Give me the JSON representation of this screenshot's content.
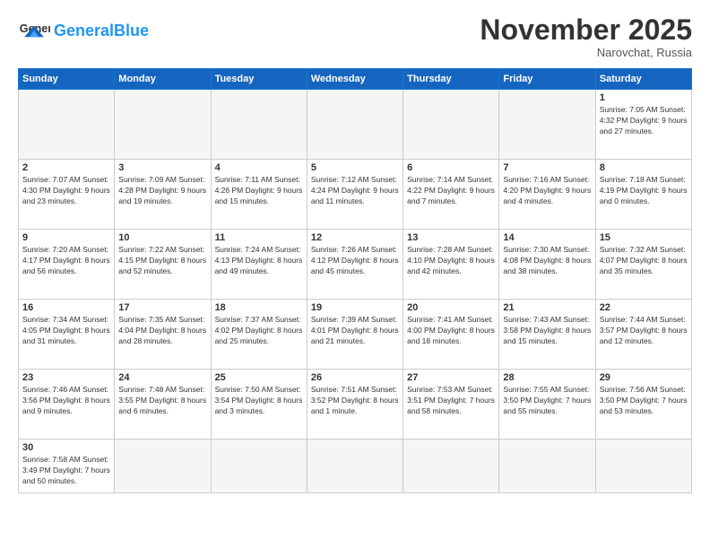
{
  "header": {
    "logo_general": "General",
    "logo_blue": "Blue",
    "month_title": "November 2025",
    "location": "Narovchat, Russia"
  },
  "days_of_week": [
    "Sunday",
    "Monday",
    "Tuesday",
    "Wednesday",
    "Thursday",
    "Friday",
    "Saturday"
  ],
  "weeks": [
    [
      {
        "day": "",
        "info": ""
      },
      {
        "day": "",
        "info": ""
      },
      {
        "day": "",
        "info": ""
      },
      {
        "day": "",
        "info": ""
      },
      {
        "day": "",
        "info": ""
      },
      {
        "day": "",
        "info": ""
      },
      {
        "day": "1",
        "info": "Sunrise: 7:05 AM\nSunset: 4:32 PM\nDaylight: 9 hours\nand 27 minutes."
      }
    ],
    [
      {
        "day": "2",
        "info": "Sunrise: 7:07 AM\nSunset: 4:30 PM\nDaylight: 9 hours\nand 23 minutes."
      },
      {
        "day": "3",
        "info": "Sunrise: 7:09 AM\nSunset: 4:28 PM\nDaylight: 9 hours\nand 19 minutes."
      },
      {
        "day": "4",
        "info": "Sunrise: 7:11 AM\nSunset: 4:26 PM\nDaylight: 9 hours\nand 15 minutes."
      },
      {
        "day": "5",
        "info": "Sunrise: 7:12 AM\nSunset: 4:24 PM\nDaylight: 9 hours\nand 11 minutes."
      },
      {
        "day": "6",
        "info": "Sunrise: 7:14 AM\nSunset: 4:22 PM\nDaylight: 9 hours\nand 7 minutes."
      },
      {
        "day": "7",
        "info": "Sunrise: 7:16 AM\nSunset: 4:20 PM\nDaylight: 9 hours\nand 4 minutes."
      },
      {
        "day": "8",
        "info": "Sunrise: 7:18 AM\nSunset: 4:19 PM\nDaylight: 9 hours\nand 0 minutes."
      }
    ],
    [
      {
        "day": "9",
        "info": "Sunrise: 7:20 AM\nSunset: 4:17 PM\nDaylight: 8 hours\nand 56 minutes."
      },
      {
        "day": "10",
        "info": "Sunrise: 7:22 AM\nSunset: 4:15 PM\nDaylight: 8 hours\nand 52 minutes."
      },
      {
        "day": "11",
        "info": "Sunrise: 7:24 AM\nSunset: 4:13 PM\nDaylight: 8 hours\nand 49 minutes."
      },
      {
        "day": "12",
        "info": "Sunrise: 7:26 AM\nSunset: 4:12 PM\nDaylight: 8 hours\nand 45 minutes."
      },
      {
        "day": "13",
        "info": "Sunrise: 7:28 AM\nSunset: 4:10 PM\nDaylight: 8 hours\nand 42 minutes."
      },
      {
        "day": "14",
        "info": "Sunrise: 7:30 AM\nSunset: 4:08 PM\nDaylight: 8 hours\nand 38 minutes."
      },
      {
        "day": "15",
        "info": "Sunrise: 7:32 AM\nSunset: 4:07 PM\nDaylight: 8 hours\nand 35 minutes."
      }
    ],
    [
      {
        "day": "16",
        "info": "Sunrise: 7:34 AM\nSunset: 4:05 PM\nDaylight: 8 hours\nand 31 minutes."
      },
      {
        "day": "17",
        "info": "Sunrise: 7:35 AM\nSunset: 4:04 PM\nDaylight: 8 hours\nand 28 minutes."
      },
      {
        "day": "18",
        "info": "Sunrise: 7:37 AM\nSunset: 4:02 PM\nDaylight: 8 hours\nand 25 minutes."
      },
      {
        "day": "19",
        "info": "Sunrise: 7:39 AM\nSunset: 4:01 PM\nDaylight: 8 hours\nand 21 minutes."
      },
      {
        "day": "20",
        "info": "Sunrise: 7:41 AM\nSunset: 4:00 PM\nDaylight: 8 hours\nand 18 minutes."
      },
      {
        "day": "21",
        "info": "Sunrise: 7:43 AM\nSunset: 3:58 PM\nDaylight: 8 hours\nand 15 minutes."
      },
      {
        "day": "22",
        "info": "Sunrise: 7:44 AM\nSunset: 3:57 PM\nDaylight: 8 hours\nand 12 minutes."
      }
    ],
    [
      {
        "day": "23",
        "info": "Sunrise: 7:46 AM\nSunset: 3:56 PM\nDaylight: 8 hours\nand 9 minutes."
      },
      {
        "day": "24",
        "info": "Sunrise: 7:48 AM\nSunset: 3:55 PM\nDaylight: 8 hours\nand 6 minutes."
      },
      {
        "day": "25",
        "info": "Sunrise: 7:50 AM\nSunset: 3:54 PM\nDaylight: 8 hours\nand 3 minutes."
      },
      {
        "day": "26",
        "info": "Sunrise: 7:51 AM\nSunset: 3:52 PM\nDaylight: 8 hours\nand 1 minute."
      },
      {
        "day": "27",
        "info": "Sunrise: 7:53 AM\nSunset: 3:51 PM\nDaylight: 7 hours\nand 58 minutes."
      },
      {
        "day": "28",
        "info": "Sunrise: 7:55 AM\nSunset: 3:50 PM\nDaylight: 7 hours\nand 55 minutes."
      },
      {
        "day": "29",
        "info": "Sunrise: 7:56 AM\nSunset: 3:50 PM\nDaylight: 7 hours\nand 53 minutes."
      }
    ],
    [
      {
        "day": "30",
        "info": "Sunrise: 7:58 AM\nSunset: 3:49 PM\nDaylight: 7 hours\nand 50 minutes."
      },
      {
        "day": "",
        "info": ""
      },
      {
        "day": "",
        "info": ""
      },
      {
        "day": "",
        "info": ""
      },
      {
        "day": "",
        "info": ""
      },
      {
        "day": "",
        "info": ""
      },
      {
        "day": "",
        "info": ""
      }
    ]
  ]
}
